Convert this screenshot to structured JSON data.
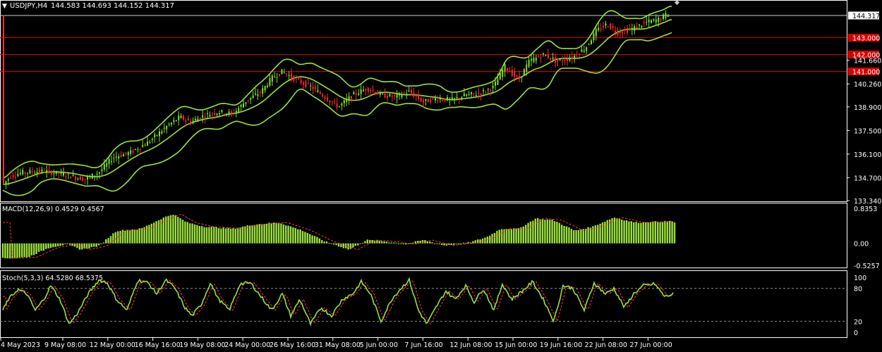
{
  "header": {
    "symbol_tf": "USDJPY,H4",
    "ohlc": "144.583 144.693 144.152 144.317"
  },
  "colors": {
    "background": "#000000",
    "candle_up": "#7fe32a",
    "candle_down": "#ff2a2a",
    "bands": "#9be23a",
    "macd_hist": "#9be23a",
    "signal": "#ff3b3b",
    "stoch_main": "#9be23a",
    "stoch_signal": "#ff3b3b",
    "level_line": "#d80000",
    "axis_text": "#ffffff",
    "grid_dash": "#8a8a8a"
  },
  "price_axis": {
    "ticks": [
      "144.317",
      "143.000",
      "142.000",
      "141.660",
      "141.000",
      "140.260",
      "138.900",
      "137.500",
      "136.100",
      "134.700",
      "133.340"
    ],
    "current_price": "144.317",
    "range": [
      133.34,
      145.5
    ]
  },
  "levels": [
    {
      "label": "143.000",
      "value": 143.0
    },
    {
      "label": "142.000",
      "value": 142.0
    },
    {
      "label": "141.000",
      "value": 141.0
    }
  ],
  "macd": {
    "label": "MACD(12,26,9) 0.4529 0.4567",
    "ticks": [
      "0.8353",
      "0.00",
      "-0.5257"
    ],
    "range": [
      -0.5257,
      0.8353
    ]
  },
  "stoch": {
    "label": "Stoch(5,3,3) 64.5280 68.5375",
    "ticks": [
      "100",
      "80",
      "20",
      "0"
    ],
    "levels": [
      80,
      20
    ]
  },
  "time_axis": [
    "4 May 2023",
    "9 May 08:00",
    "12 May 00:00",
    "16 May 16:00",
    "19 May 08:00",
    "24 May 00:00",
    "26 May 16:00",
    "31 May 08:00",
    "5 Jun 00:00",
    "7 Jun 16:00",
    "12 Jun 08:00",
    "15 Jun 00:00",
    "19 Jun 16:00",
    "22 Jun 08:00",
    "27 Jun 00:00"
  ],
  "chart_data": {
    "type": "candlestick",
    "series": [
      {
        "name": "USDJPY,H4",
        "x": [
          "4 May 2023",
          "9 May 08:00",
          "12 May 00:00",
          "16 May 16:00",
          "19 May 08:00",
          "24 May 00:00",
          "26 May 16:00",
          "31 May 08:00",
          "5 Jun 00:00",
          "7 Jun 16:00",
          "12 Jun 08:00",
          "15 Jun 00:00",
          "19 Jun 16:00",
          "22 Jun 08:00",
          "27 Jun 00:00"
        ],
        "values": [
          134.3,
          135.1,
          134.9,
          137.0,
          137.8,
          139.4,
          140.5,
          139.2,
          139.7,
          139.3,
          139.6,
          141.0,
          141.6,
          143.2,
          144.3
        ]
      }
    ],
    "ylim": [
      133.34,
      145.5
    ]
  }
}
